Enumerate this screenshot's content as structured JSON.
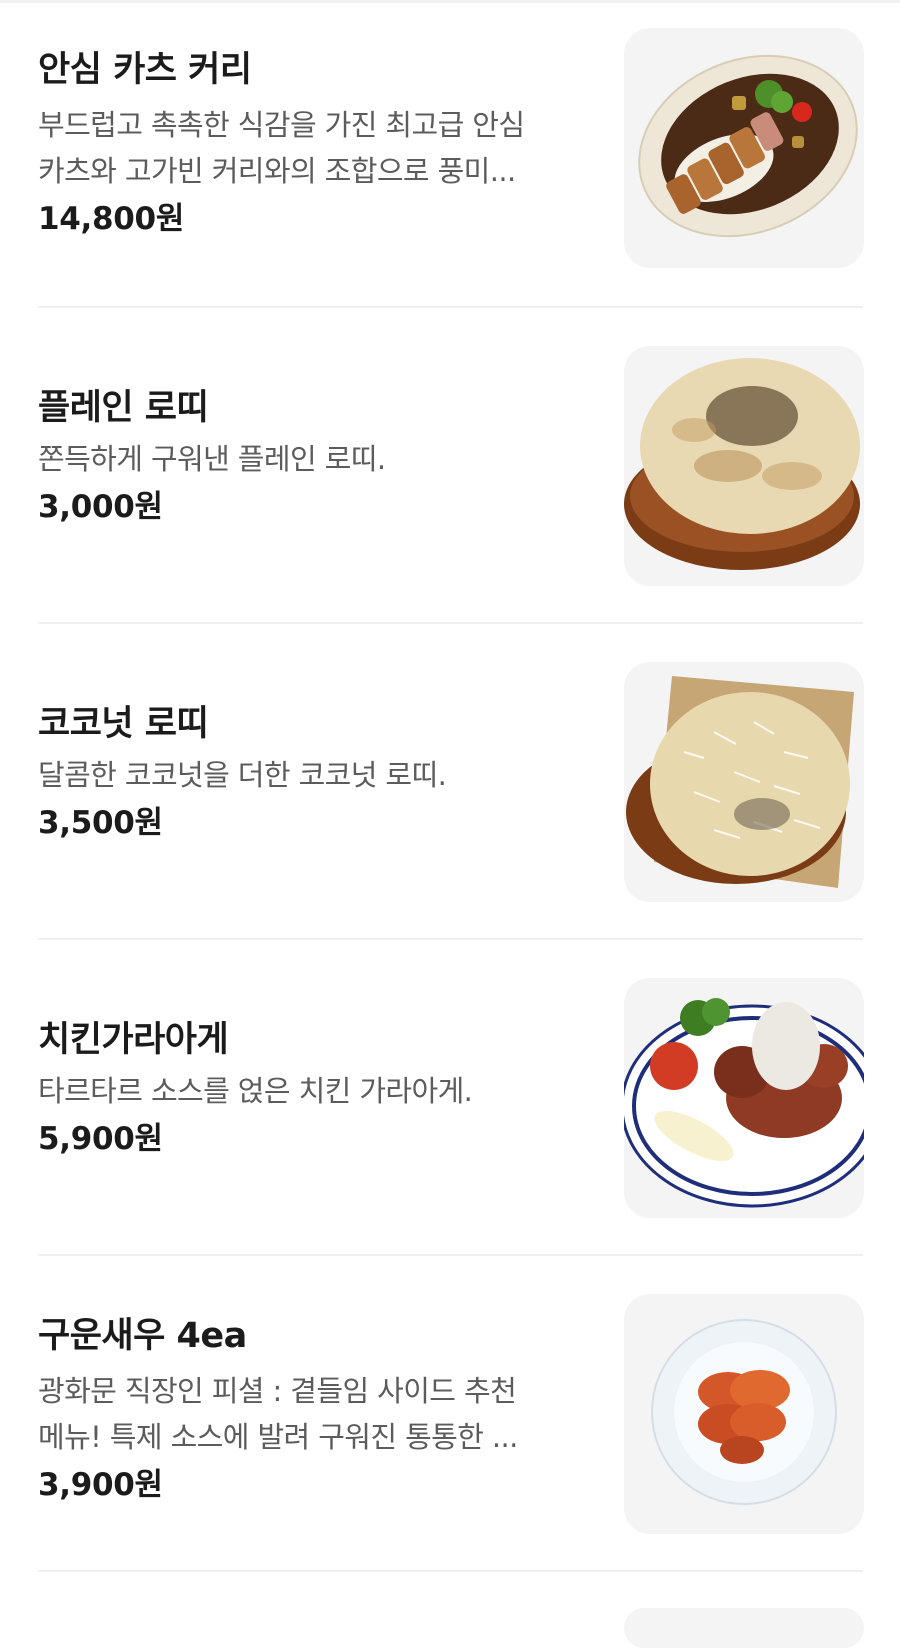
{
  "menu": {
    "items": [
      {
        "name": "안심 카츠 커리",
        "desc_line1": "부드럽고 촉촉한 식감을 가진 최고급 안심",
        "desc_line2": "카츠와 고가빈 커리와의 조합으로 풍미...",
        "price": "14,800원",
        "image_icon": "katsu-curry-icon"
      },
      {
        "name": "플레인 로띠",
        "desc_line1": "쫀득하게 구워낸 플레인 로띠.",
        "price": "3,000원",
        "image_icon": "plain-roti-icon"
      },
      {
        "name": "코코넛 로띠",
        "desc_line1": "달콤한 코코넛을 더한 코코넛 로띠.",
        "price": "3,500원",
        "image_icon": "coconut-roti-icon"
      },
      {
        "name": "치킨가라아게",
        "desc_line1": "타르타르 소스를 얹은 치킨 가라아게.",
        "price": "5,900원",
        "image_icon": "chicken-karaage-icon"
      },
      {
        "name": "구운새우 4ea",
        "desc_line1": "광화문 직장인 피셜 : 곁들임 사이드 추천",
        "desc_line2": "메뉴! 특제 소스에 발려 구워진 통통한 ...",
        "price": "3,900원",
        "image_icon": "grilled-shrimp-icon"
      }
    ]
  }
}
